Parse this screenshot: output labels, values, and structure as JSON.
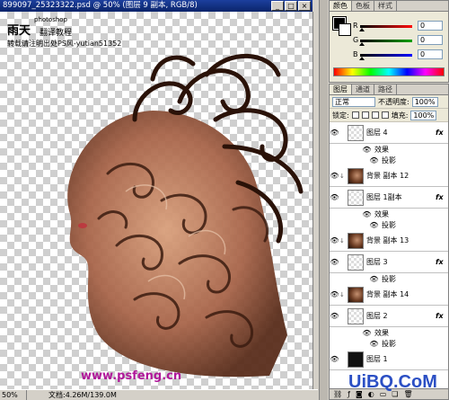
{
  "document": {
    "title": "899097_25323322.psd @ 50% (图层 9 副本, RGB/8)",
    "min_btn": "_",
    "max_btn": "□",
    "close_btn": "×",
    "zoom": "50%",
    "doc_info": "文档:4.26M/139.0M",
    "credit_title": "雨天",
    "credit_sub": "photoshop",
    "credit_sub2": "翻译教程",
    "credit_note": "转载请注明出处PS风-yutian51352",
    "watermark_left": "www.psfeng.cn",
    "watermark_right": "UiBQ.CoM"
  },
  "color_panel": {
    "tabs": [
      "颜色",
      "色板",
      "样式"
    ],
    "active_tab": 0,
    "sliders": [
      {
        "label": "R",
        "value": "0",
        "color": "#ff0000"
      },
      {
        "label": "G",
        "value": "0",
        "color": "#00a000"
      },
      {
        "label": "B",
        "value": "0",
        "color": "#0000ff"
      }
    ]
  },
  "layers_panel": {
    "tabs": [
      "图层",
      "通道",
      "路径"
    ],
    "active_tab": 0,
    "blend_mode": "正常",
    "opacity_label": "不透明度:",
    "opacity": "100%",
    "lock_label": "锁定:",
    "fill_label": "填充:",
    "fill": "100%",
    "layers": [
      {
        "kind": "layer",
        "name": "图层 4",
        "thumb": "pattern",
        "fx": "fx",
        "linked": false
      },
      {
        "kind": "effects",
        "name": "效果"
      },
      {
        "kind": "effect",
        "name": "投影"
      },
      {
        "kind": "layer",
        "name": "背景 副本 12",
        "thumb": "photo",
        "fx": "",
        "linked": true
      },
      {
        "kind": "layer",
        "name": "图层 1副本",
        "thumb": "pattern",
        "fx": "fx",
        "linked": false
      },
      {
        "kind": "effects",
        "name": "效果"
      },
      {
        "kind": "effect",
        "name": "投影"
      },
      {
        "kind": "layer",
        "name": "背景 副本 13",
        "thumb": "photo",
        "fx": "",
        "linked": true
      },
      {
        "kind": "layer",
        "name": "图层 3",
        "thumb": "pattern",
        "fx": "fx",
        "linked": false
      },
      {
        "kind": "effect",
        "name": "投影"
      },
      {
        "kind": "layer",
        "name": "背景 副本 14",
        "thumb": "photo",
        "fx": "",
        "linked": true
      },
      {
        "kind": "layer",
        "name": "图层 2",
        "thumb": "pattern",
        "fx": "fx",
        "linked": false
      },
      {
        "kind": "effects",
        "name": "效果"
      },
      {
        "kind": "effect",
        "name": "投影"
      },
      {
        "kind": "layer",
        "name": "图层 1",
        "thumb": "dark",
        "fx": "",
        "linked": false
      }
    ]
  }
}
